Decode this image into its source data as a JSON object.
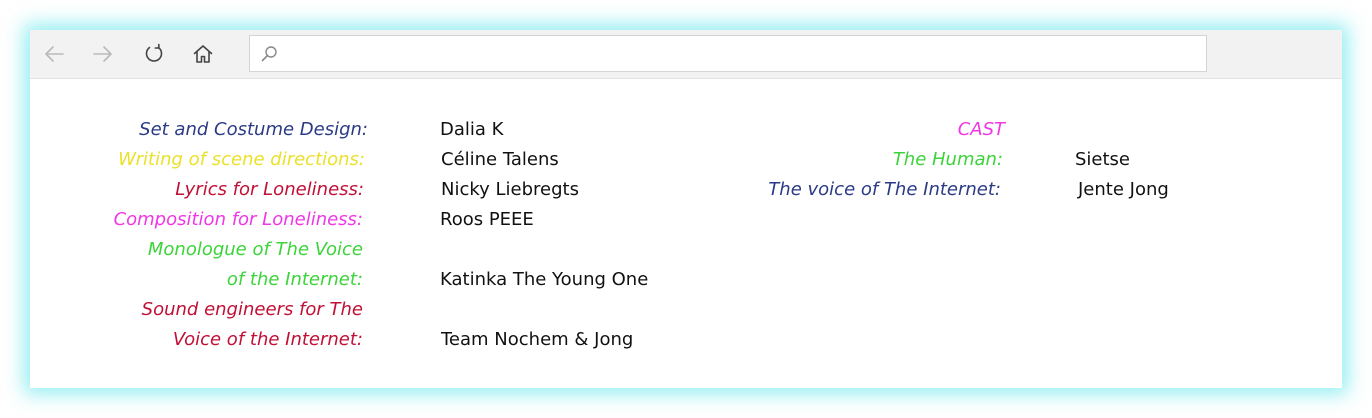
{
  "colors": {
    "navy": "#2b3a86",
    "yellow": "#ebe02a",
    "crimson": "#c10f36",
    "magenta": "#f037e6",
    "green": "#3cd43a",
    "glow": "#40e0e8"
  },
  "toolbar": {
    "back_icon": "arrow-left-icon",
    "forward_icon": "arrow-right-icon",
    "refresh_icon": "refresh-icon",
    "home_icon": "home-icon",
    "search_icon": "search-icon",
    "address_value": ""
  },
  "credits": [
    {
      "label": "Set and Costume Design:",
      "value": "Dalia K",
      "color": "#2b3a86"
    },
    {
      "label": "Writing of scene directions:",
      "value": "Céline Talens",
      "color": "#ebe02a"
    },
    {
      "label": "Lyrics for Loneliness:",
      "value": "Nicky Liebregts",
      "color": "#c10f36"
    },
    {
      "label": "Composition for Loneliness:",
      "value": "Roos PEEE",
      "color": "#f037e6"
    },
    {
      "label_line1": "Monologue of The Voice",
      "label_line2": "of the Internet:",
      "value": "Katinka The Young One",
      "color": "#3cd43a"
    },
    {
      "label_line1": "Sound engineers for The",
      "label_line2": "Voice of the Internet:",
      "value": "Team Nochem & Jong",
      "color": "#c10f36"
    }
  ],
  "cast": {
    "heading": "CAST",
    "heading_color": "#f037e6",
    "members": [
      {
        "role": "The Human:",
        "name": "Sietse",
        "color": "#3cd43a"
      },
      {
        "role": "The voice of The Internet:",
        "name": "Jente Jong",
        "color": "#2b3a86"
      }
    ]
  }
}
